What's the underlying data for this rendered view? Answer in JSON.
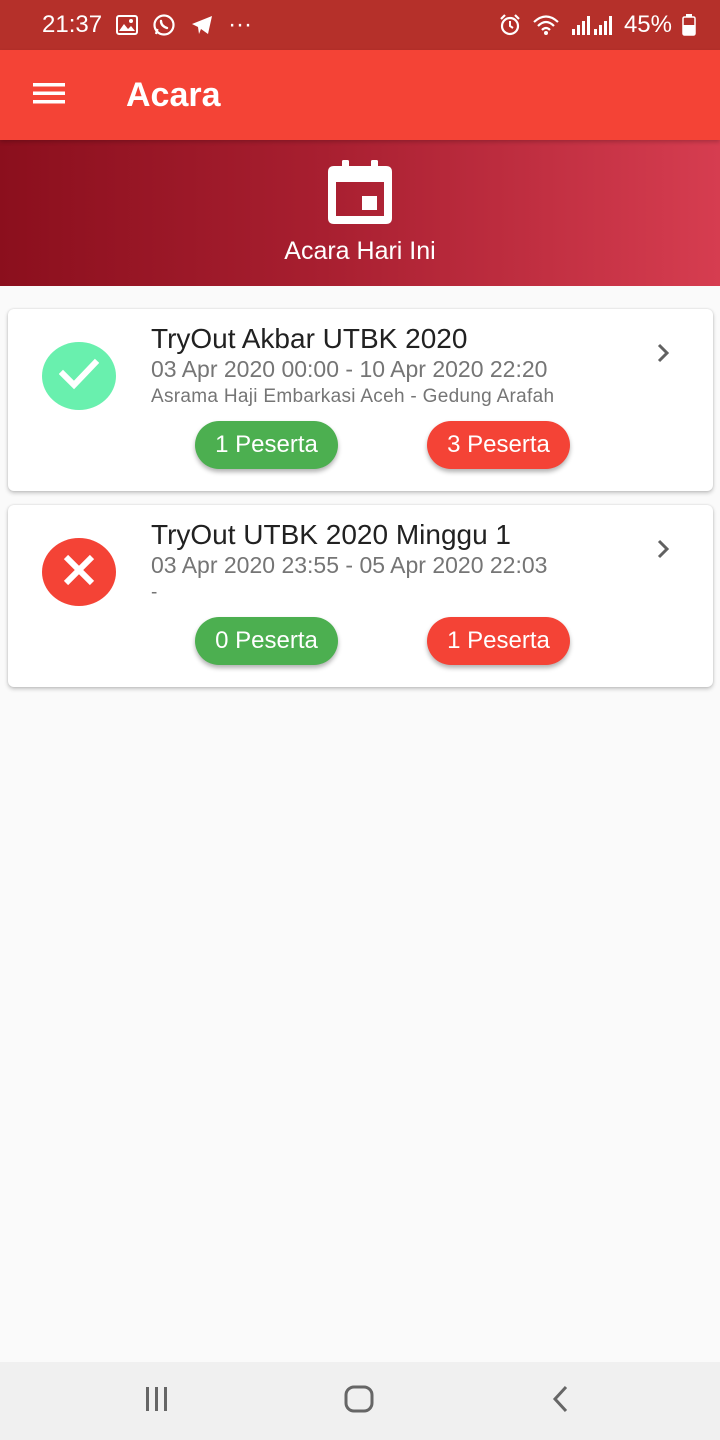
{
  "status_bar": {
    "time": "21:37",
    "more": "···",
    "battery": "45%",
    "icons": [
      "gallery-icon",
      "whatsapp-icon",
      "telegram-icon",
      "alarm-icon",
      "wifi-icon",
      "signal-icon",
      "battery-icon"
    ]
  },
  "app_bar": {
    "title": "Acara",
    "menu_icon": "menu-icon"
  },
  "banner": {
    "icon": "calendar-icon",
    "label": "Acara Hari Ini"
  },
  "events": [
    {
      "title": "TryOut Akbar UTBK 2020",
      "date_range": "03 Apr 2020 00:00 - 10 Apr 2020 22:20",
      "location": "Asrama Haji Embarkasi Aceh - Gedung Arafah",
      "status": "active",
      "status_icon": "check-icon",
      "green_count": "1 Peserta",
      "red_count": "3 Peserta"
    },
    {
      "title": "TryOut UTBK 2020 Minggu 1",
      "date_range": "03 Apr 2020 23:55 - 05 Apr 2020 22:03",
      "location": "-",
      "status": "inactive",
      "status_icon": "close-icon",
      "green_count": "0 Peserta",
      "red_count": "1 Peserta"
    }
  ],
  "colors": {
    "status_bar": "#b5302a",
    "app_bar": "#f44336",
    "green": "#4caf50",
    "red": "#f44336",
    "ok": "#69f0ae"
  },
  "nav_bar": {
    "icons": [
      "recents-icon",
      "home-icon",
      "back-icon"
    ]
  }
}
